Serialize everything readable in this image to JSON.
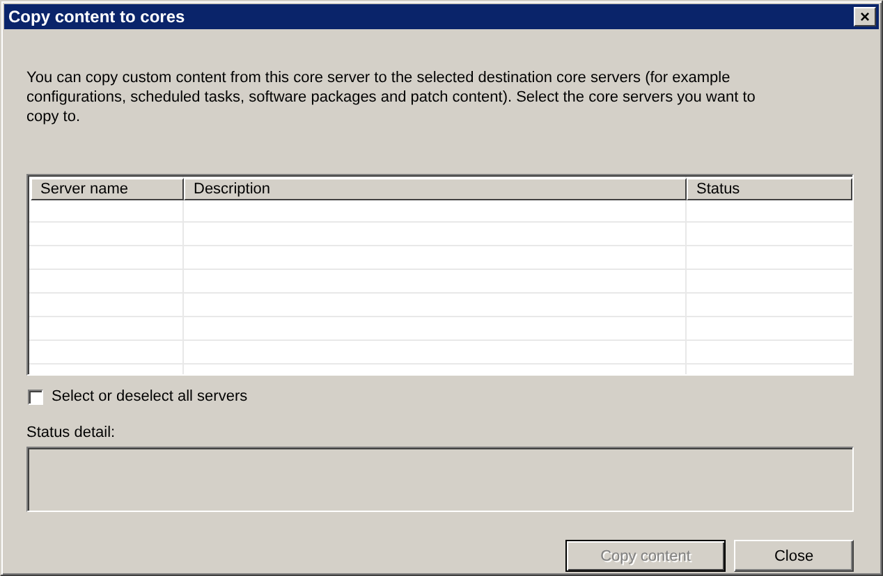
{
  "window": {
    "title": "Copy content to cores",
    "close_symbol": "×"
  },
  "intro": "You can copy custom content from this core server to the selected destination core servers (for example configurations, scheduled tasks, software packages and patch content). Select the core servers you want to copy to.",
  "table": {
    "columns": [
      "Server name",
      "Description",
      "Status"
    ]
  },
  "select_all": {
    "label": "Select or deselect all servers",
    "checked": false
  },
  "status_detail": {
    "label": "Status detail:"
  },
  "buttons": [
    {
      "label": "Copy content",
      "disabled": true,
      "default": true
    },
    {
      "label": "Close",
      "disabled": false,
      "default": false
    }
  ]
}
